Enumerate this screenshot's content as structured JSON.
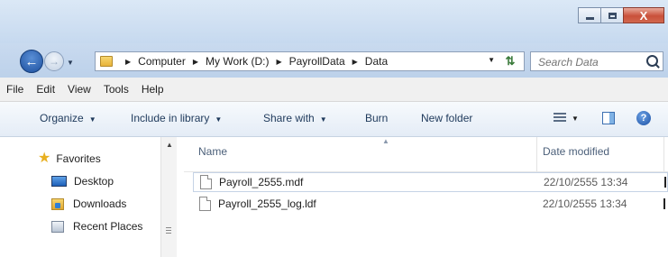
{
  "window": {
    "caption_buttons": {
      "close_label": "X"
    }
  },
  "address": {
    "crumbs": [
      "Computer",
      "My Work (D:)",
      "PayrollData",
      "Data"
    ],
    "search_placeholder": "Search Data"
  },
  "menu": [
    "File",
    "Edit",
    "View",
    "Tools",
    "Help"
  ],
  "commands": {
    "organize": "Organize",
    "include": "Include in library",
    "share": "Share with",
    "burn": "Burn",
    "new_folder": "New folder"
  },
  "nav": {
    "items": [
      {
        "label": "Favorites",
        "icon": "star-icon"
      },
      {
        "label": "Desktop",
        "icon": "desktop-icon"
      },
      {
        "label": "Downloads",
        "icon": "downloads-icon"
      },
      {
        "label": "Recent Places",
        "icon": "recent-places-icon"
      }
    ]
  },
  "columns": {
    "name": "Name",
    "date": "Date modified"
  },
  "files": [
    {
      "name": "Payroll_2555.mdf",
      "date": "22/10/2555 13:34"
    },
    {
      "name": "Payroll_2555_log.ldf",
      "date": "22/10/2555 13:34"
    }
  ],
  "colors": {
    "titlebar": "#c6d9ef",
    "close": "#c9503a",
    "header_text": "#4c607a"
  }
}
